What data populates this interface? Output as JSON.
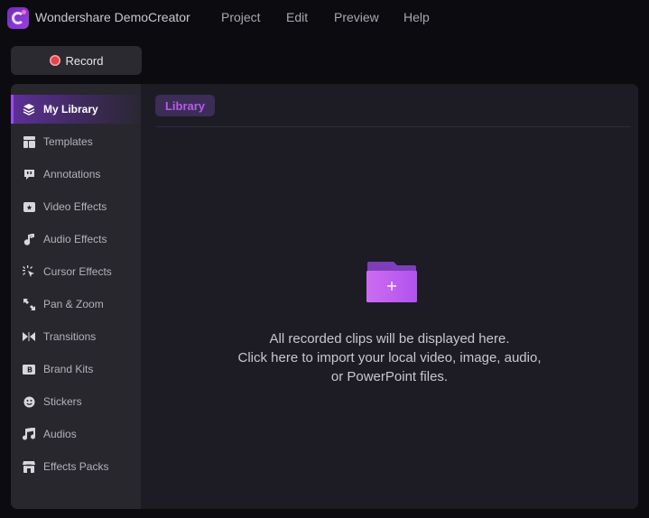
{
  "titlebar": {
    "app_title": "Wondershare DemoCreator",
    "menus": [
      "Project",
      "Edit",
      "Preview",
      "Help"
    ]
  },
  "record_button": {
    "label": "Record"
  },
  "sidebar": {
    "items": [
      {
        "label": "My Library",
        "icon": "layers-icon",
        "active": true
      },
      {
        "label": "Templates",
        "icon": "template-icon"
      },
      {
        "label": "Annotations",
        "icon": "speech-bubble-icon"
      },
      {
        "label": "Video Effects",
        "icon": "video-effects-icon"
      },
      {
        "label": "Audio Effects",
        "icon": "music-note-icon"
      },
      {
        "label": "Cursor Effects",
        "icon": "cursor-click-icon"
      },
      {
        "label": "Pan & Zoom",
        "icon": "pan-zoom-icon"
      },
      {
        "label": "Transitions",
        "icon": "transition-icon"
      },
      {
        "label": "Brand Kits",
        "icon": "brand-kit-icon"
      },
      {
        "label": "Stickers",
        "icon": "smiley-icon"
      },
      {
        "label": "Audios",
        "icon": "music-icon"
      },
      {
        "label": "Effects Packs",
        "icon": "store-icon"
      }
    ]
  },
  "main": {
    "tab_label": "Library",
    "empty_state": {
      "icon": "folder-add-icon",
      "line1": "All recorded clips will be displayed here.",
      "line2": "Click here to import your local video, image, audio,",
      "line3": "or PowerPoint files."
    }
  },
  "colors": {
    "accent": "#9c4ef0",
    "tab_text": "#b55be9",
    "record_dot": "#e8434b"
  }
}
